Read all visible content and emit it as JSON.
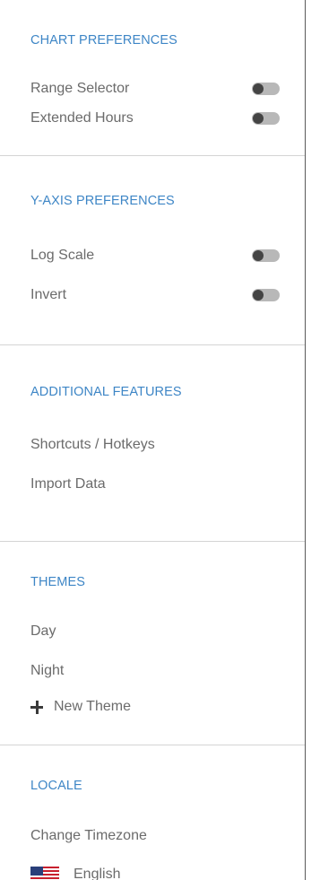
{
  "chart_preferences": {
    "title": "CHART PREFERENCES",
    "items": [
      {
        "label": "Range Selector",
        "enabled": false
      },
      {
        "label": "Extended Hours",
        "enabled": false
      }
    ]
  },
  "yaxis_preferences": {
    "title": "Y-AXIS PREFERENCES",
    "items": [
      {
        "label": "Log Scale",
        "enabled": false
      },
      {
        "label": "Invert",
        "enabled": false
      }
    ]
  },
  "additional_features": {
    "title": "ADDITIONAL FEATURES",
    "items": [
      {
        "label": "Shortcuts / Hotkeys"
      },
      {
        "label": "Import Data"
      }
    ]
  },
  "themes": {
    "title": "THEMES",
    "items": [
      {
        "label": "Day"
      },
      {
        "label": "Night"
      }
    ],
    "new_theme_label": "New Theme",
    "new_theme_icon": "plus-icon"
  },
  "locale": {
    "title": "LOCALE",
    "change_timezone_label": "Change Timezone",
    "language_label": "English",
    "language_icon": "us-flag-icon"
  },
  "colors": {
    "section_title": "#3e86c6",
    "item_text": "#6b6b6b",
    "toggle_track": "#b8b8b8",
    "toggle_knob": "#444444"
  }
}
